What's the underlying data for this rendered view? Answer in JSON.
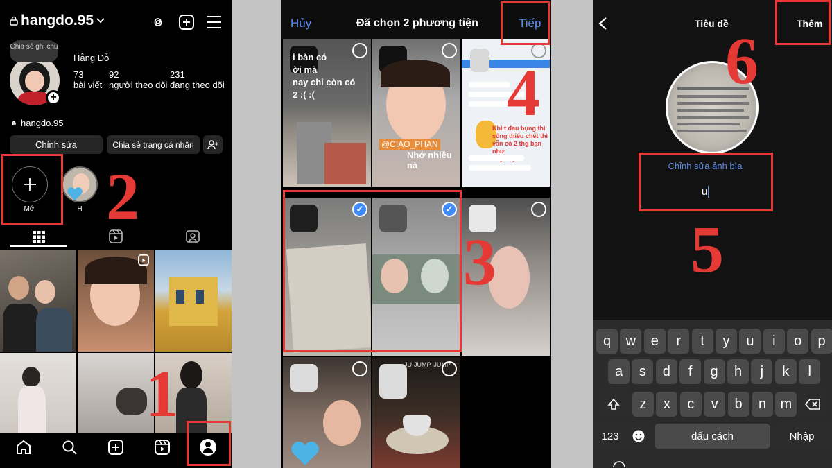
{
  "screen1": {
    "username": "hangdo.95",
    "note_bubble": "Chia sẻ ghi chú",
    "display_name": "Hằng Đỗ",
    "stats": [
      {
        "count": "73",
        "label": "bài viết"
      },
      {
        "count": "92",
        "label": "người theo dõi"
      },
      {
        "count": "231",
        "label": "đang theo dõi"
      }
    ],
    "threads_handle": "hangdo.95",
    "edit_button": "Chỉnh sửa",
    "share_button": "Chia sẻ trang cá nhân",
    "highlight_new_label": "Mới",
    "highlight_h_label": "H"
  },
  "screen2": {
    "cancel": "Hủy",
    "title": "Đã chọn 2 phương tiện",
    "next": "Tiếp",
    "cell1_text": "i bàn có\nời mà\nnay chỉ còn có\n2 :( :(",
    "cell2_tag": "@CIAO_PHAN",
    "cell2_caption": "Nhớ nhiều nà",
    "cell3_caption": "Khi t đau bụng thì\nsông thiếu chết thì\nvẫn có 2 thg bạn như\nnày đây!!!",
    "cell8_text": "JU-JUMP, JUMP"
  },
  "screen3": {
    "title": "Tiêu đề",
    "add": "Thêm",
    "edit_cover": "Chỉnh sửa ảnh bìa",
    "input_value": "u",
    "keyboard_row1": [
      "q",
      "w",
      "e",
      "r",
      "t",
      "y",
      "u",
      "i",
      "o",
      "p"
    ],
    "keyboard_row2": [
      "a",
      "s",
      "d",
      "f",
      "g",
      "h",
      "j",
      "k",
      "l"
    ],
    "keyboard_row3": [
      "z",
      "x",
      "c",
      "v",
      "b",
      "n",
      "m"
    ],
    "key_123": "123",
    "key_space": "dấu cách",
    "key_enter": "Nhập"
  },
  "steps": {
    "s1": "1",
    "s2": "2",
    "s3": "3",
    "s4": "4",
    "s5": "5",
    "s6": "6"
  },
  "colors": {
    "accent_red": "#e53935",
    "ig_blue": "#3d8bfd"
  }
}
